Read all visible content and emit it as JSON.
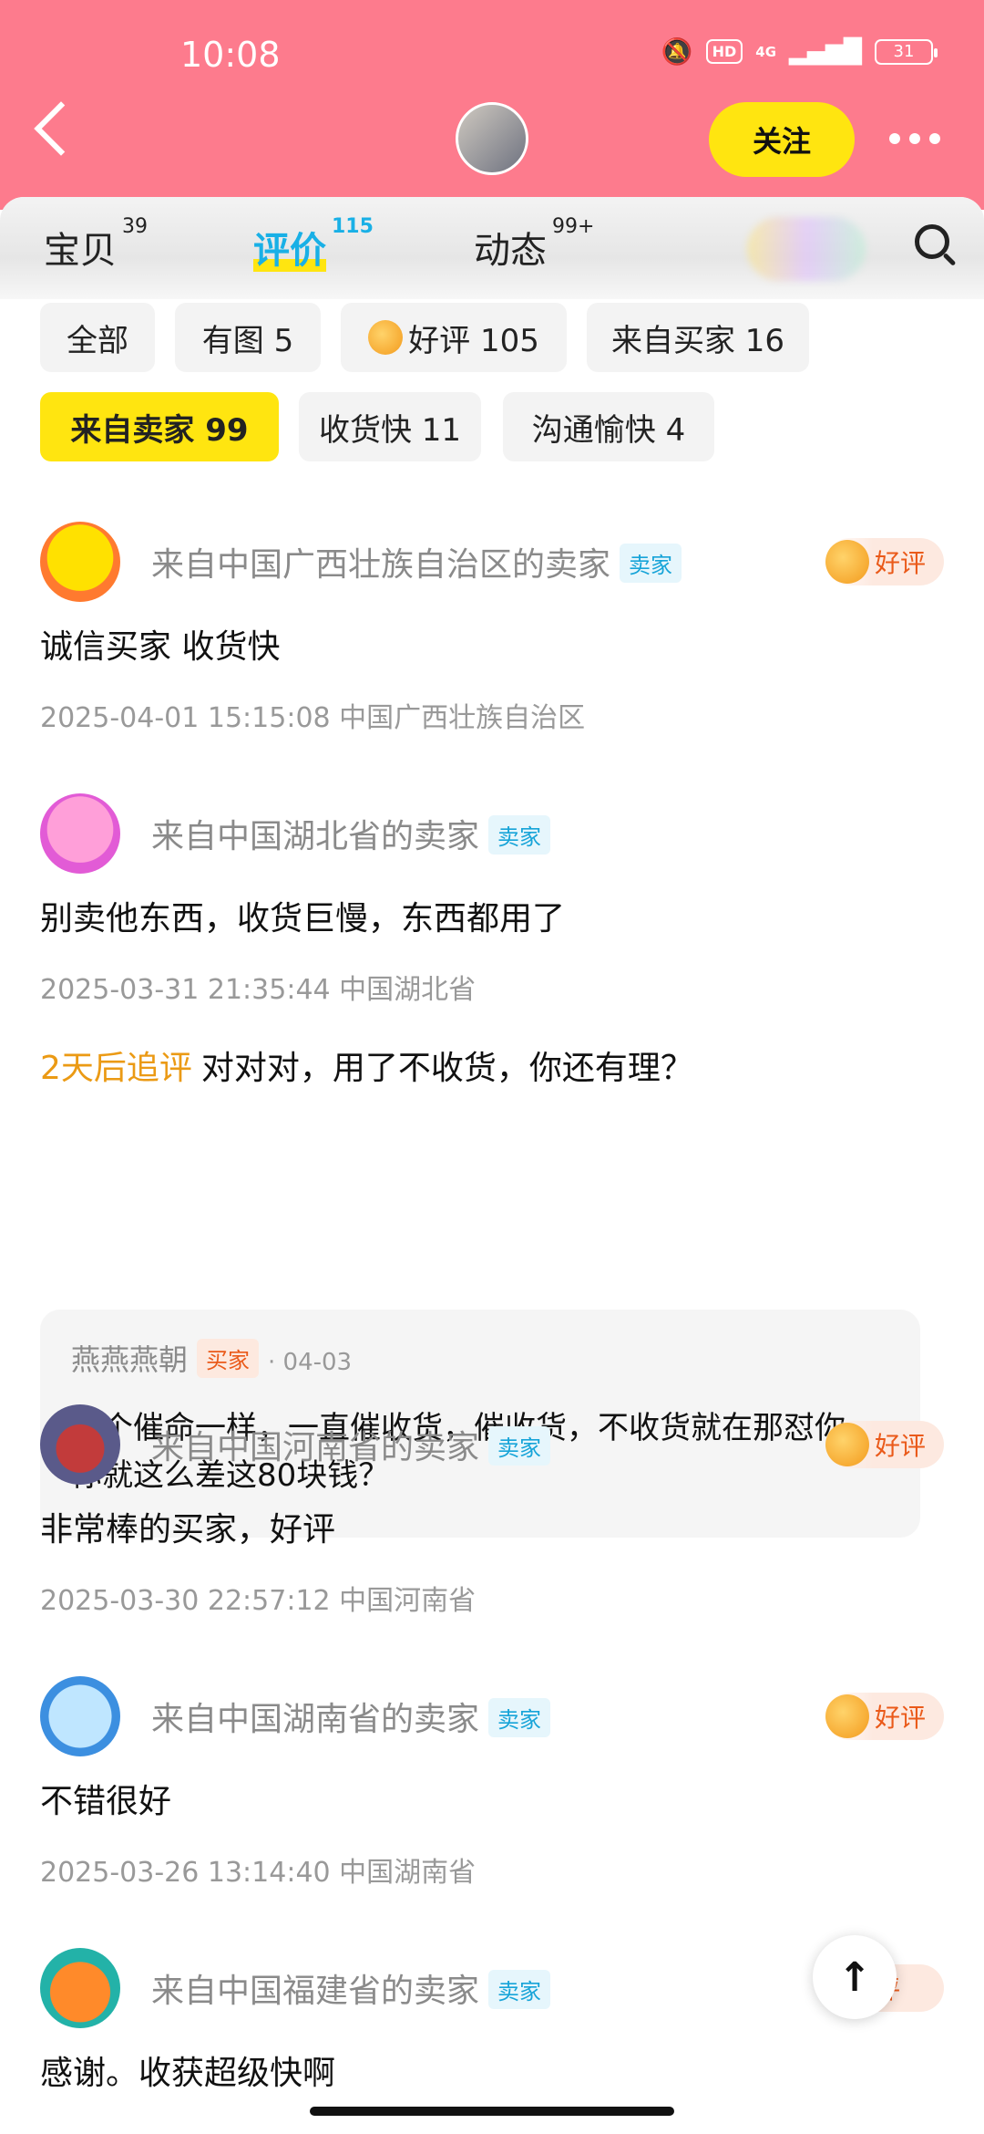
{
  "status_bar": {
    "time": "10:08",
    "network": "4G",
    "hd": "HD",
    "battery": "31"
  },
  "header": {
    "follow_label": "关注"
  },
  "tabs": [
    {
      "label": "宝贝",
      "count": "39"
    },
    {
      "label": "评价",
      "count": "115"
    },
    {
      "label": "动态",
      "count": "99+"
    }
  ],
  "filters": {
    "row1": [
      "全部",
      "有图 5",
      "好评 105",
      "来自买家 16"
    ],
    "row2": [
      "来自卖家 99",
      "收货快 11",
      "沟通愉快 4"
    ]
  },
  "reviews": [
    {
      "name": "来自中国广西壮族自治区的卖家",
      "role": "卖家",
      "rating": "好评",
      "content": "诚信买家 收货快",
      "meta": "2025-04-01 15:15:08  中国广西壮族自治区"
    },
    {
      "name": "来自中国湖北省的卖家",
      "role": "卖家",
      "content": "别卖他东西，收货巨慢，东西都用了",
      "meta": "2025-03-31 21:35:44  中国湖北省",
      "followup_tag": "2天后追评",
      "followup_text": "对对对，用了不收货，你还有理？",
      "reply": {
        "name": "燕燕燕朝",
        "role": "买家",
        "date": "· 04-03",
        "text": "跟个催命一样，一直催收货，催收货，不收货就在那怼你，你就这么差这80块钱？"
      }
    },
    {
      "name": "来自中国河南省的卖家",
      "role": "卖家",
      "rating": "好评",
      "content": "非常棒的买家，好评",
      "meta": "2025-03-30 22:57:12  中国河南省"
    },
    {
      "name": "来自中国湖南省的卖家",
      "role": "卖家",
      "rating": "好评",
      "content": "不错很好",
      "meta": "2025-03-26 13:14:40  中国湖南省"
    },
    {
      "name": "来自中国福建省的卖家",
      "role": "卖家",
      "rating": "评",
      "content": "感谢。收获超级快啊"
    }
  ],
  "fab": {
    "icon": "arrow-up-icon",
    "glyph": "↑"
  }
}
